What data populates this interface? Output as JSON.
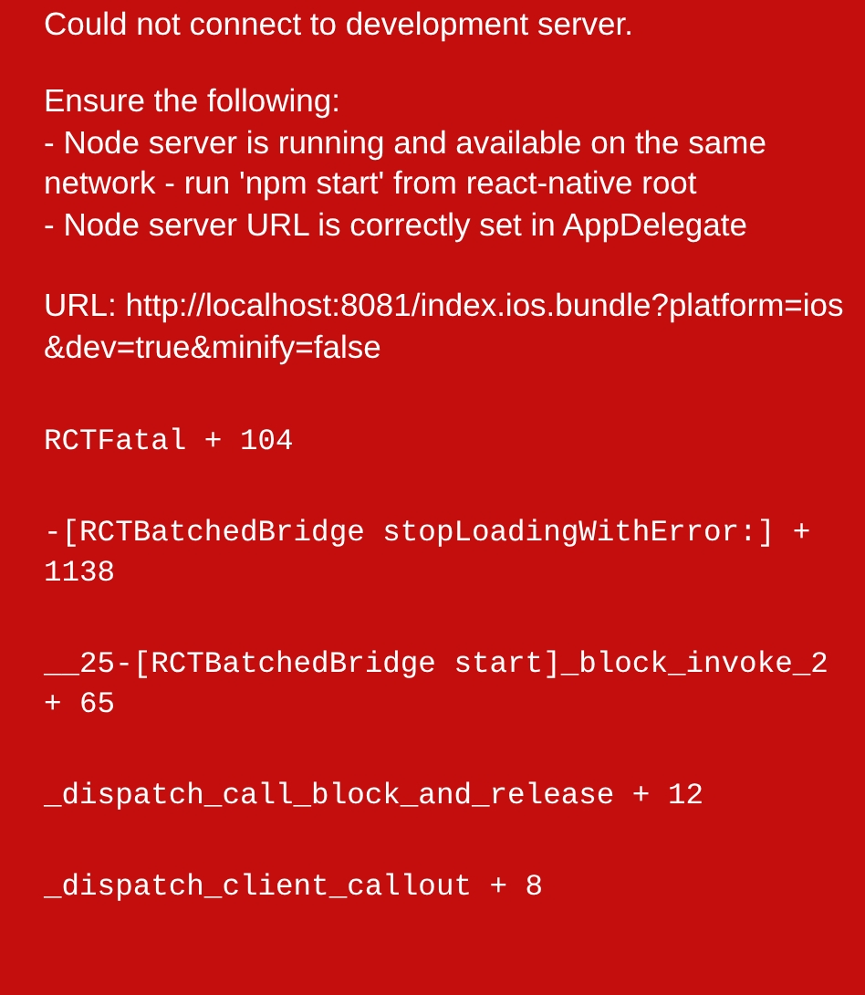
{
  "message": {
    "title": "Could not connect to development server.",
    "lines": [
      "Ensure the following:",
      "- Node server is running and available on the same network - run 'npm start' from react-native root",
      "- Node server URL is correctly set in AppDelegate"
    ],
    "url": "URL: http://localhost:8081/index.ios.bundle?platform=ios&dev=true&minify=false"
  },
  "stack_trace": [
    {
      "text": "RCTFatal + 104"
    },
    {
      "text": "-[RCTBatchedBridge stopLoadingWithError:] + 1138"
    },
    {
      "text": "__25-[RCTBatchedBridge start]_block_invoke_2 + 65"
    },
    {
      "text": "_dispatch_call_block_and_release + 12"
    },
    {
      "text": "_dispatch_client_callout + 8"
    }
  ]
}
